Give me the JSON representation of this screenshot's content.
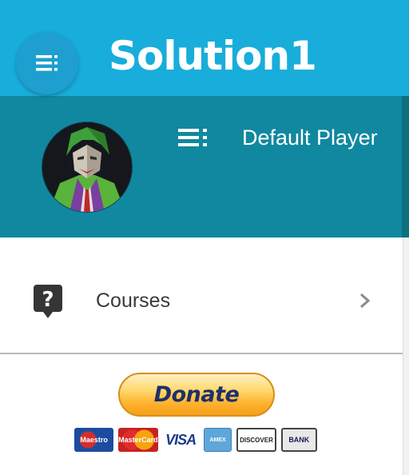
{
  "app": {
    "title": "Solution1",
    "accent_color": "#18addb",
    "menu_icon": "menu-icon"
  },
  "drawer": {
    "header_color": "#10889f",
    "player_name": "Default Player",
    "avatar": "joker-avatar",
    "menu_icon": "menu-icon"
  },
  "menu": {
    "items": [
      {
        "label": "Courses",
        "icon": "help-bubble-icon",
        "trailing_icon": "chevron-right-icon"
      }
    ]
  },
  "donate": {
    "label": "Donate",
    "cards": [
      {
        "name": "maestro",
        "label": "Maestro"
      },
      {
        "name": "mastercard",
        "label": "MasterCard"
      },
      {
        "name": "visa",
        "label": "VISA"
      },
      {
        "name": "amex",
        "label": "AMEX"
      },
      {
        "name": "discover",
        "label": "DISCOVER"
      },
      {
        "name": "bank",
        "label": "BANK"
      }
    ]
  }
}
